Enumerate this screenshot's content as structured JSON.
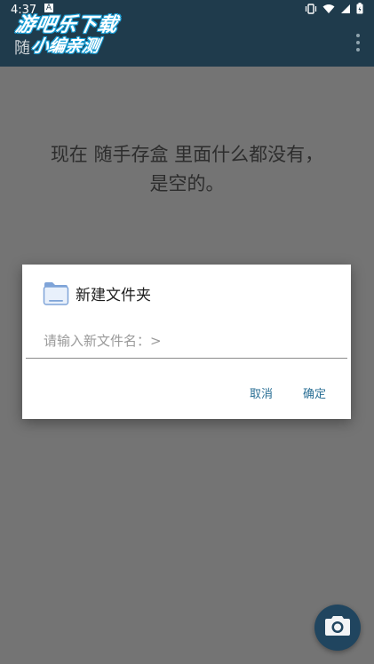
{
  "status_bar": {
    "time": "4:37",
    "notification_letter": "A",
    "icons": [
      "vibrate-icon",
      "wifi-icon",
      "signal-icon",
      "battery-icon"
    ]
  },
  "app_bar": {
    "title": "随",
    "overflow_icon": "more-vert-icon"
  },
  "watermark": {
    "line1": "游吧乐下载",
    "line2": "小编亲测"
  },
  "empty_state": {
    "line1": "现在 随手存盒 里面什么都没有，",
    "line2": "是空的。"
  },
  "dialog": {
    "icon": "folder-icon",
    "title": "新建文件夹",
    "input_placeholder": "请输入新文件名：>",
    "input_value": "",
    "cancel_label": "取消",
    "ok_label": "确定"
  },
  "fab": {
    "icon": "camera-icon"
  },
  "colors": {
    "app_bar": "#1f3b4c",
    "scrim_background": "#747474",
    "dialog_button": "#2a6f95",
    "fab": "#20455f"
  }
}
